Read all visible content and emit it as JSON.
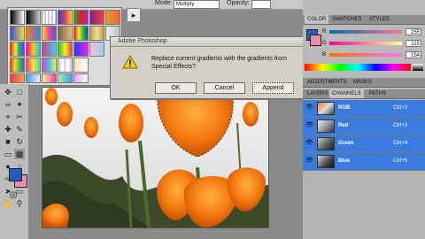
{
  "options_bar": {
    "mode_label": "Mode:",
    "mode_value": "Multiply",
    "opacity_label": "Opacity:"
  },
  "toolbox": {
    "tools": [
      "move-icon",
      "marquee-icon",
      "lasso-icon",
      "magic-wand-icon",
      "crop-icon",
      "slice-icon",
      "healing-brush-icon",
      "brush-icon",
      "stamp-icon",
      "history-brush-icon",
      "eraser-icon",
      "gradient-icon",
      "blur-icon",
      "dodge-icon",
      "pen-icon",
      "type-icon",
      "path-select-icon",
      "shape-icon",
      "hand-icon",
      "zoom-icon"
    ]
  },
  "colors": {
    "foreground": "#1f5cc8",
    "background": "#f18cb0"
  },
  "gradient_picker": {
    "menu_arrow": "▸"
  },
  "dialog": {
    "title": "Adobe Photoshop",
    "message": "Replace current gradients with the gradients from Special Effects?",
    "ok": "OK",
    "cancel": "Cancel",
    "append": "Append"
  },
  "color_panel": {
    "tabs": [
      "COLOR",
      "SWATCHES",
      "STYLES"
    ],
    "rows": [
      {
        "label": "R",
        "value": "255"
      },
      {
        "label": "G",
        "value": "115"
      },
      {
        "label": "B",
        "value": "154"
      }
    ]
  },
  "channels_panel": {
    "tabs": [
      "ADJUSTMENTS",
      "MASKS"
    ],
    "subtabs": [
      "LAYERS",
      "CHANNELS",
      "PATHS"
    ],
    "channels": [
      {
        "name": "RGB",
        "shortcut": "Ctrl+2"
      },
      {
        "name": "Red",
        "shortcut": "Ctrl+3"
      },
      {
        "name": "Green",
        "shortcut": "Ctrl+4"
      },
      {
        "name": "Blue",
        "shortcut": "Ctrl+5"
      }
    ]
  }
}
